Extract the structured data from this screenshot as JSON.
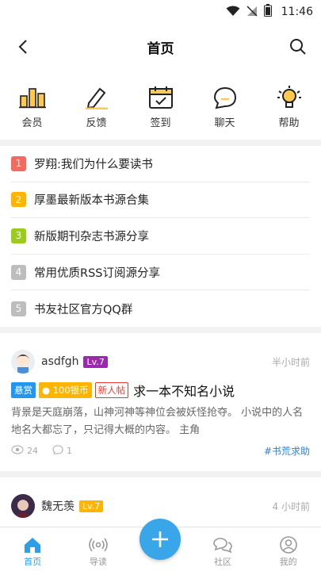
{
  "status": {
    "time": "11:46"
  },
  "nav": {
    "title": "首页"
  },
  "quick": [
    {
      "label": "会员",
      "icon": "member-icon"
    },
    {
      "label": "反馈",
      "icon": "feedback-icon"
    },
    {
      "label": "签到",
      "icon": "checkin-icon"
    },
    {
      "label": "聊天",
      "icon": "chat-icon"
    },
    {
      "label": "帮助",
      "icon": "help-icon"
    }
  ],
  "notices": [
    {
      "num": "1",
      "color": "#f26b5e",
      "text": "罗翔:我们为什么要读书"
    },
    {
      "num": "2",
      "color": "#ffb400",
      "text": "厚墨最新版本书源合集"
    },
    {
      "num": "3",
      "color": "#9ccc1a",
      "text": "新版期刊杂志书源分享"
    },
    {
      "num": "4",
      "color": "#bdbdbd",
      "text": "常用优质RSS订阅源分享"
    },
    {
      "num": "5",
      "color": "#bdbdbd",
      "text": "书友社区官方QQ群"
    }
  ],
  "posts": [
    {
      "user": "asdfgh",
      "level": "Lv.7",
      "level_color": "#9c27b0",
      "time": "半小时前",
      "tag_reward": "悬赏",
      "tag_coin": "100银币",
      "tag_new": "新人帖",
      "title": "求一本不知名小说",
      "body": "背景是天庭崩落，山神河神等神位会被妖怪抢夺。 小说中的人名地名大都忘了，只记得大概的内容。 主角",
      "views": "24",
      "comments": "1",
      "topic": "#书荒求助"
    },
    {
      "user": "魏无羡",
      "level": "Lv.7",
      "level_color": "#ffb400",
      "time": "4 小时前"
    }
  ],
  "tabs": [
    {
      "label": "首页",
      "icon": "home-icon"
    },
    {
      "label": "导读",
      "icon": "broadcast-icon"
    },
    {
      "label": "社区",
      "icon": "community-icon"
    },
    {
      "label": "我的",
      "icon": "profile-icon"
    }
  ]
}
